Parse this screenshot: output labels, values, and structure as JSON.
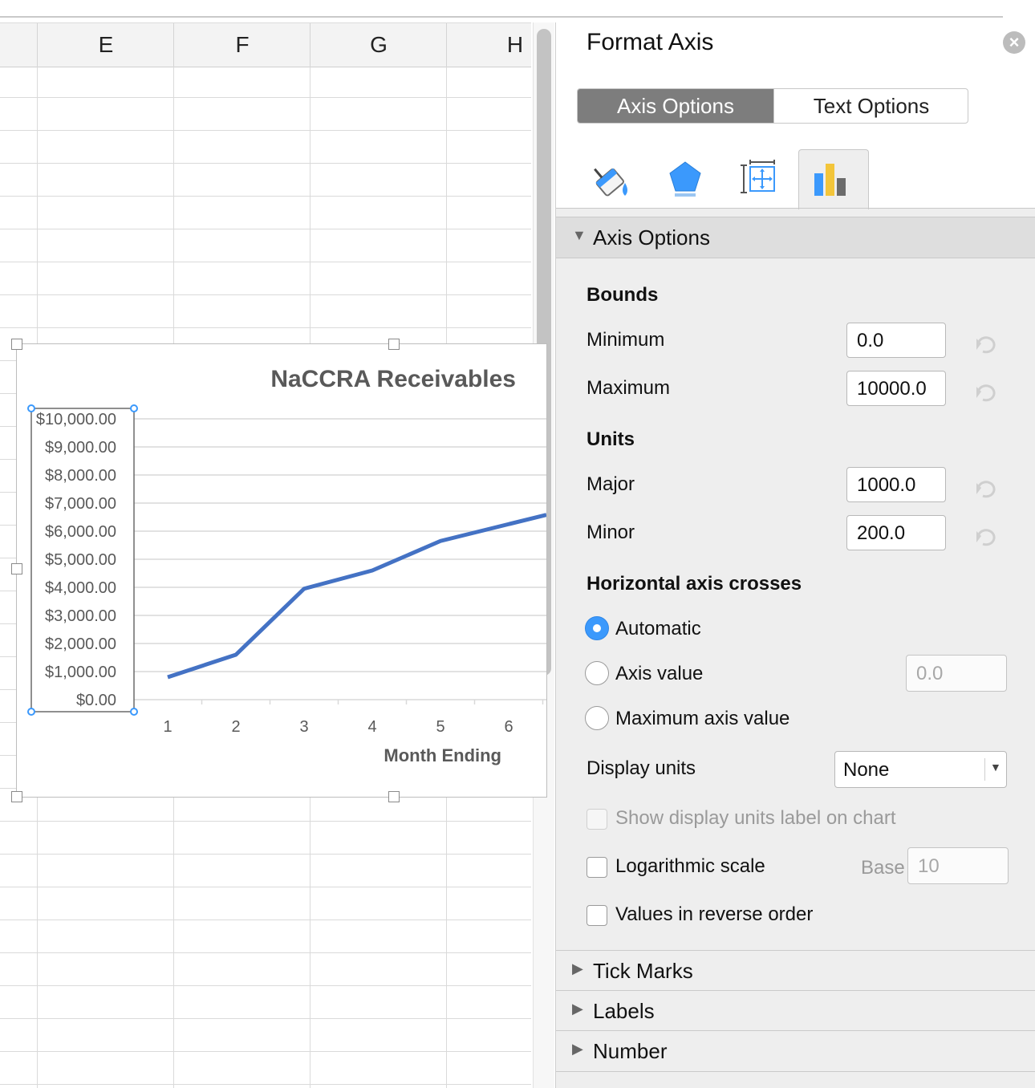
{
  "sheet": {
    "columns": [
      "E",
      "F",
      "G",
      "H"
    ]
  },
  "chart_data": {
    "type": "line",
    "title": "NaCCRA Receivables",
    "xlabel": "Month Ending",
    "ylabel": "",
    "categories": [
      "1",
      "2",
      "3",
      "4",
      "5",
      "6"
    ],
    "series": [
      {
        "values": [
          800,
          1600,
          3950,
          4600,
          5650,
          6250
        ],
        "color": "#4472c4"
      }
    ],
    "ylim": [
      0,
      10000
    ],
    "y_tick_labels": [
      "$10,000.00",
      "$9,000.00",
      "$8,000.00",
      "$7,000.00",
      "$6,000.00",
      "$5,000.00",
      "$4,000.00",
      "$3,000.00",
      "$2,000.00",
      "$1,000.00",
      "$0.00"
    ],
    "grid": true,
    "legend": "none"
  },
  "pane": {
    "title": "Format Axis",
    "close_icon": "close-icon",
    "tabs": [
      "Axis Options",
      "Text Options"
    ],
    "icon_tabs": [
      "fill-line-icon",
      "effects-icon",
      "size-properties-icon",
      "axis-options-icon"
    ],
    "section_axis_options": "Axis Options",
    "bounds_heading": "Bounds",
    "minimum_label": "Minimum",
    "minimum_value": "0.0",
    "maximum_label": "Maximum",
    "maximum_value": "10000.0",
    "units_heading": "Units",
    "major_label": "Major",
    "major_value": "1000.0",
    "minor_label": "Minor",
    "minor_value": "200.0",
    "crosses_heading": "Horizontal axis crosses",
    "opt_automatic": "Automatic",
    "opt_axis_value": "Axis value",
    "axis_value_placeholder": "0.0",
    "opt_max_axis_value": "Maximum axis value",
    "display_units_label": "Display units",
    "display_units_value": "None",
    "show_units_label": "Show display units label on chart",
    "log_scale_label": "Logarithmic scale",
    "base_label": "Base",
    "base_value": "10",
    "reverse_label": "Values in reverse order",
    "section_tick_marks": "Tick Marks",
    "section_labels": "Labels",
    "section_number": "Number"
  },
  "colors": {
    "accent": "#3b99fc",
    "series": "#4472c4"
  }
}
